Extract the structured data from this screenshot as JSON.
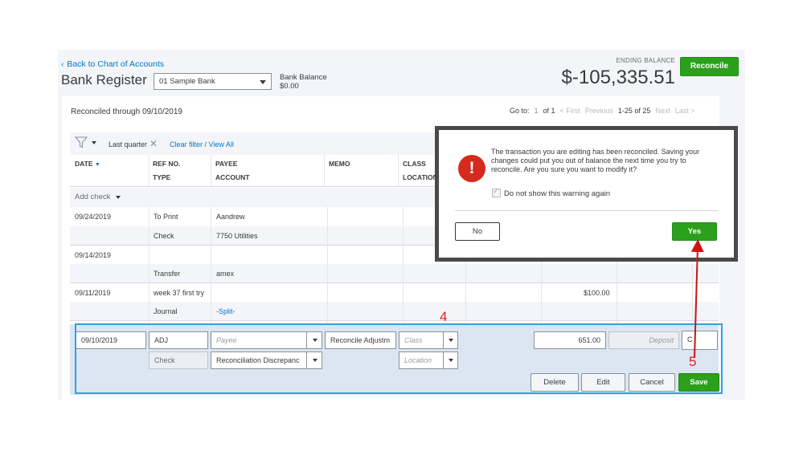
{
  "header": {
    "back_link": "Back to Chart of Accounts",
    "title": "Bank Register",
    "account_select": "01 Sample Bank",
    "bank_balance_label": "Bank Balance",
    "bank_balance_value": "$0.00",
    "ending_balance_label": "ENDING BALANCE",
    "ending_balance_value": "$-105,335.51",
    "reconcile_button": "Reconcile"
  },
  "toolbar": {
    "reconciled_through": "Reconciled through 09/10/2019",
    "goto_label": "Go to:",
    "page_input": "1",
    "of_pages": "of 1",
    "first": "< First",
    "previous": "Previous",
    "range": "1-25 of 25",
    "next": "Next",
    "last": "Last >"
  },
  "filter": {
    "date_filter": "Last quarter",
    "clear_link": "Clear filter / View All"
  },
  "columns": {
    "date": "DATE",
    "ref_no": "REF NO.",
    "type": "TYPE",
    "payee": "PAYEE",
    "account": "ACCOUNT",
    "memo": "MEMO",
    "class": "CLASS",
    "location": "LOCATION"
  },
  "add_check": "Add check",
  "rows": [
    {
      "date": "09/24/2019",
      "ref": "To Print",
      "type": "Check",
      "payee": "Aandrew",
      "account": "7750 Utilities",
      "amount": ""
    },
    {
      "date": "09/14/2019",
      "ref": "",
      "type": "Transfer",
      "payee": "",
      "account": "amex",
      "amount": ""
    },
    {
      "date": "09/11/2019",
      "ref": "week 37 first try",
      "type": "Journal",
      "payee": "",
      "account": "-Split-",
      "amount": "$100.00"
    }
  ],
  "edit_row": {
    "date": "09/10/2019",
    "ref": "ADJ",
    "type": "Check",
    "payee_placeholder": "Payee",
    "account": "Reconciliation Discrepanc",
    "memo": "Reconcile Adjustm",
    "class_placeholder": "Class",
    "location_placeholder": "Location",
    "payment": "651.00",
    "deposit_placeholder": "Deposit",
    "status": "C",
    "buttons": {
      "delete": "Delete",
      "edit": "Edit",
      "cancel": "Cancel",
      "save": "Save"
    }
  },
  "dialog": {
    "message": "The transaction you are editing has been reconciled. Saving your changes could put you out of balance the next time you try to reconcile. Are you sure you want to modify it?",
    "checkbox_label": "Do not show this warning again",
    "no_button": "No",
    "yes_button": "Yes"
  },
  "annotations": {
    "step4": "4",
    "step5": "5"
  },
  "colors": {
    "accent_green": "#2ca01c",
    "link_blue": "#0077c5",
    "annotation_red": "#e02020",
    "highlight_blue": "#2ea3e6",
    "warning_red": "#d52b1e"
  }
}
